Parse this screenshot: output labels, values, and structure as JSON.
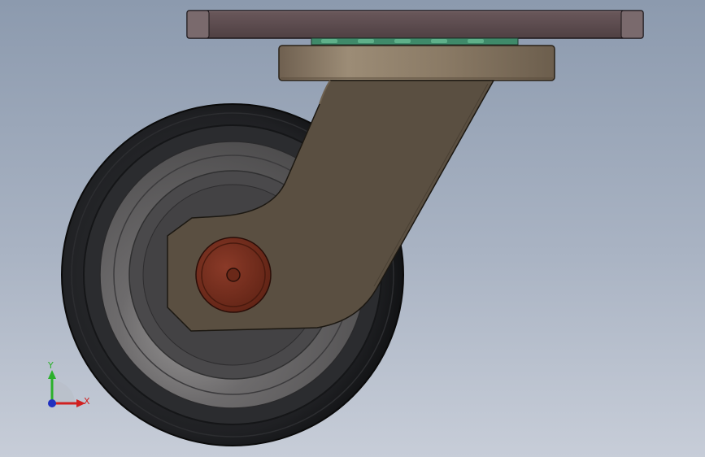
{
  "viewport": {
    "background_top": "#8c9aae",
    "background_bottom": "#c7cdd8"
  },
  "model": {
    "parts": [
      "top-mounting-plate",
      "swivel-bearing-raceway",
      "swivel-housing",
      "caster-fork-leg",
      "wheel-tire",
      "wheel-hub",
      "axle-bolt"
    ],
    "colors": {
      "plate": "#5a4a4c",
      "housing": "#8c7c68",
      "fork": "#5a4f41",
      "tire": "#1e1f22",
      "hub": "#646264",
      "axle": "#7a3020",
      "bearing": "#3f8a6a"
    }
  },
  "triad": {
    "y_label": "Y",
    "x_label": "X",
    "y_color": "#2bb02b",
    "x_color": "#d02020",
    "z_color": "#2030c0"
  }
}
